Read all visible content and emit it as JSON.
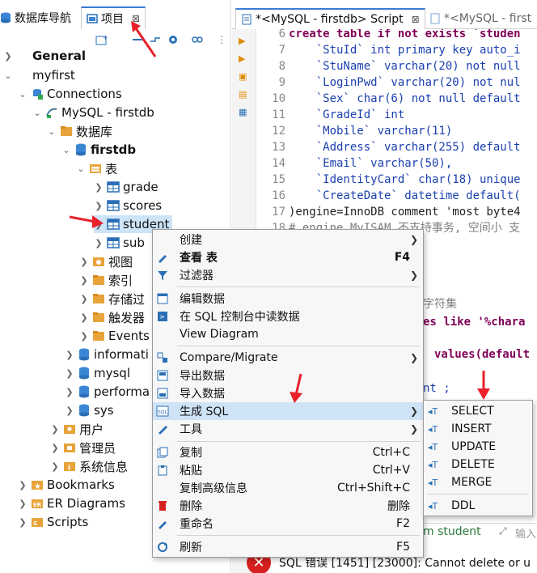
{
  "left_panel": {
    "tabs": [
      {
        "label": "数据库导航"
      },
      {
        "label": "项目",
        "close": "⊠"
      }
    ],
    "tree": [
      {
        "label": "General",
        "bold": true
      },
      {
        "label": "myfirst"
      },
      {
        "label": "Connections"
      },
      {
        "label": "MySQL - firstdb"
      },
      {
        "label": "数据库"
      },
      {
        "label": "firstdb",
        "bold": true
      },
      {
        "label": "表"
      },
      {
        "label": "grade"
      },
      {
        "label": "scores"
      },
      {
        "label": "student"
      },
      {
        "label": "sub"
      },
      {
        "label": "视图"
      },
      {
        "label": "索引"
      },
      {
        "label": "存储过"
      },
      {
        "label": "触发器"
      },
      {
        "label": "Events"
      },
      {
        "label": "informati"
      },
      {
        "label": "mysql"
      },
      {
        "label": "performa"
      },
      {
        "label": "sys"
      },
      {
        "label": "用户"
      },
      {
        "label": "管理员"
      },
      {
        "label": "系统信息"
      },
      {
        "label": "Bookmarks"
      },
      {
        "label": "ER Diagrams"
      },
      {
        "label": "Scripts"
      }
    ]
  },
  "editor": {
    "tabs": [
      {
        "label": "*<MySQL - firstdb> Script",
        "close": "⊠"
      },
      {
        "label": "*<MySQL - first"
      }
    ],
    "lines": [
      {
        "num": "6",
        "text": "create table if not exists `studen"
      },
      {
        "num": "7",
        "text": "    `StuId` int primary key auto_i"
      },
      {
        "num": "8",
        "text": "    `StuName` varchar(20) not null"
      },
      {
        "num": "9",
        "text": "    `LoginPwd` varchar(20) not nul"
      },
      {
        "num": "10",
        "text": "    `Sex` char(6) not null default"
      },
      {
        "num": "11",
        "text": "    `GradeId` int"
      },
      {
        "num": "12",
        "text": "    `Mobile` varchar(11)"
      },
      {
        "num": "13",
        "text": "    `Address` varchar(255) default"
      },
      {
        "num": "14",
        "text": "    `Email` varchar(50),"
      },
      {
        "num": "15",
        "text": "    `IdentityCard` char(18) unique"
      },
      {
        "num": "16",
        "text": "    `CreateDate` datetime default("
      },
      {
        "num": "17",
        "text": ")engine=InnoDB comment 'most byte4"
      },
      {
        "num": "18",
        "text": "# engine MyISAM 不支持事务, 空间小 支"
      }
    ],
    "behind_menu_fragments": {
      "charset_comment": "字符集",
      "like_line": "es like '%chara",
      "values_line": "values(default",
      "nt_line": "nt ;",
      "from_student": "m student",
      "input_hint": "输入"
    },
    "error_text": "SQL 错误 [1451] [23000]: Cannot delete or u"
  },
  "context_menu": {
    "items": [
      {
        "label": "创建",
        "submenu": true
      },
      {
        "label": "查看 表",
        "shortcut": "F4",
        "bold": true
      },
      {
        "label": "过滤器",
        "submenu": true
      },
      {
        "label": "编辑数据"
      },
      {
        "label": "在 SQL 控制台中读数据"
      },
      {
        "label": "View Diagram"
      },
      {
        "label": "Compare/Migrate",
        "submenu": true
      },
      {
        "label": "导出数据"
      },
      {
        "label": "导入数据"
      },
      {
        "label": "生成 SQL",
        "submenu": true,
        "highlighted": true
      },
      {
        "label": "工具",
        "submenu": true
      },
      {
        "label": "复制",
        "shortcut": "Ctrl+C"
      },
      {
        "label": "粘贴",
        "shortcut": "Ctrl+V"
      },
      {
        "label": "复制高级信息",
        "shortcut": "Ctrl+Shift+C"
      },
      {
        "label": "删除",
        "shortcut": "删除"
      },
      {
        "label": "重命名",
        "shortcut": "F2"
      },
      {
        "label": "刷新",
        "shortcut": "F5"
      }
    ]
  },
  "submenu": {
    "items": [
      {
        "label": "SELECT"
      },
      {
        "label": "INSERT"
      },
      {
        "label": "UPDATE"
      },
      {
        "label": "DELETE"
      },
      {
        "label": "MERGE"
      },
      {
        "label": "DDL"
      }
    ]
  },
  "colors": {
    "selection": "#cde4f7",
    "menu_highlight": "#cfe3f6",
    "annotation_red": "#e8212b",
    "keyword": "#7f0055",
    "identifier": "#1a3fb0",
    "string": "#2a9f2a"
  }
}
